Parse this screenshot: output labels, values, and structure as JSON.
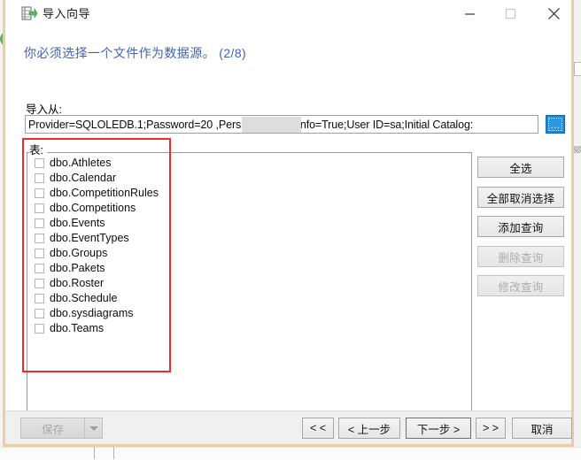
{
  "window": {
    "title": "导入向导",
    "icon": "import-wizard-icon",
    "controls": {
      "minimize": "—",
      "maximize": "□",
      "close": "✕"
    }
  },
  "content": {
    "subtitle": "你必须选择一个文件作为数据源。 (2/8)",
    "import_from_label": "导入从:",
    "connection_string": "Provider=SQLOLEDB.1;Password=20                  ,Persist Security Info=True;User ID=sa;Initial Catalog:",
    "browse_button": "...",
    "tables_label": "表:"
  },
  "tables": [
    {
      "name": "dbo.Athletes",
      "checked": false
    },
    {
      "name": "dbo.Calendar",
      "checked": false
    },
    {
      "name": "dbo.CompetitionRules",
      "checked": false
    },
    {
      "name": "dbo.Competitions",
      "checked": false
    },
    {
      "name": "dbo.Events",
      "checked": false
    },
    {
      "name": "dbo.EventTypes",
      "checked": false
    },
    {
      "name": "dbo.Groups",
      "checked": false
    },
    {
      "name": "dbo.Pakets",
      "checked": false
    },
    {
      "name": "dbo.Roster",
      "checked": false
    },
    {
      "name": "dbo.Schedule",
      "checked": false
    },
    {
      "name": "dbo.sysdiagrams",
      "checked": false
    },
    {
      "name": "dbo.Teams",
      "checked": false
    }
  ],
  "side_buttons": [
    {
      "label": "全选",
      "enabled": true
    },
    {
      "label": "全部取消选择",
      "enabled": true
    },
    {
      "label": "添加查询",
      "enabled": true
    },
    {
      "label": "删除查询",
      "enabled": false
    },
    {
      "label": "修改查询",
      "enabled": false
    }
  ],
  "footer": {
    "save_label": "保存",
    "save_enabled": false,
    "nav_buttons": [
      {
        "label": "< <",
        "default": false
      },
      {
        "label": "< 上一步",
        "default": false
      },
      {
        "label": "下一步 >",
        "default": true
      },
      {
        "label": "> >",
        "default": false
      },
      {
        "label": "取消",
        "default": false
      }
    ]
  },
  "annotation": {
    "type": "red-rectangle-highlight",
    "color": "#ee2b2b",
    "target": "tables-list"
  },
  "colors": {
    "window_border": "#e8cfa6",
    "subtitle": "#3f62b5",
    "accent_browse": "#1e87d6",
    "annotation": "#ee2b2b",
    "redaction": "#dddddd"
  }
}
